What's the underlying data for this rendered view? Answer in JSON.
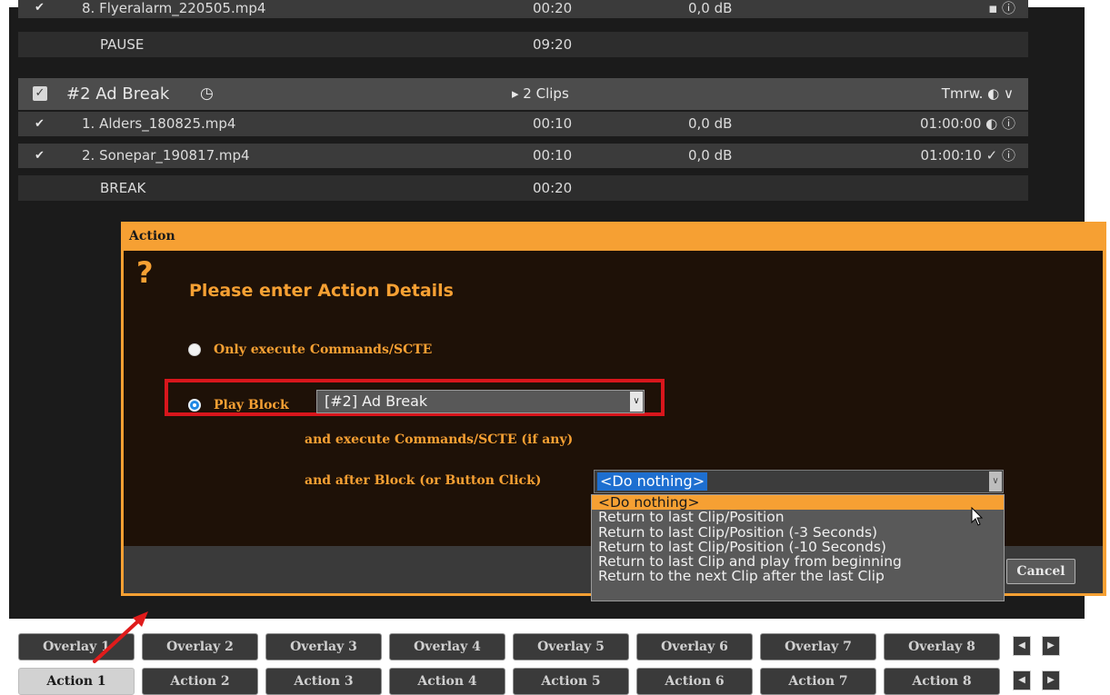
{
  "playlist": {
    "top_clip": {
      "check": "✔",
      "name": "8. Flyeralarm_220505.mp4",
      "duration": "00:20",
      "gain": "0,0 dB",
      "right": "▪ ⓘ"
    },
    "pause_row": {
      "label": "PAUSE",
      "duration": "09:20"
    },
    "block": {
      "check": "✓",
      "title": "#2 Ad Break",
      "clock_icon": "clock-icon",
      "clock_glyph": "◷",
      "clips": "▸ 2 Clips",
      "right": "Tmrw. ◐ ∨"
    },
    "clips": [
      {
        "check": "✔",
        "name": "1. Alders_180825.mp4",
        "duration": "00:10",
        "gain": "0,0 dB",
        "right": "01:00:00 ◐ ⓘ"
      },
      {
        "check": "✔",
        "name": "2. Sonepar_190817.mp4",
        "duration": "00:10",
        "gain": "0,0 dB",
        "right": "01:00:10 ✓ ⓘ"
      }
    ],
    "break_row": {
      "label": "BREAK",
      "duration": "00:20"
    }
  },
  "dialog": {
    "title": "Action",
    "icon": "?",
    "heading": "Please enter Action Details",
    "option_commands": "Only execute Commands/SCTE",
    "option_play_block": "Play Block",
    "block_select_value": "[#2] Ad Break",
    "exec_text": "and execute Commands/SCTE (if any)",
    "after_label": "and after Block (or Button Click)",
    "after_select_value": "<Do nothing>",
    "after_options": [
      "<Do nothing>",
      "Return to last Clip/Position",
      "Return to last Clip/Position (-3 Seconds)",
      "Return to last Clip/Position (-10 Seconds)",
      "Return to last Clip and play from beginning",
      "Return to the next Clip after the last Clip"
    ],
    "selected_option_index": 0,
    "cancel_label": "Cancel"
  },
  "overlay_buttons": [
    "Overlay 1",
    "Overlay 2",
    "Overlay 3",
    "Overlay 4",
    "Overlay 5",
    "Overlay 6",
    "Overlay 7",
    "Overlay 8"
  ],
  "action_buttons": [
    "Action 1",
    "Action 2",
    "Action 3",
    "Action 4",
    "Action 5",
    "Action 6",
    "Action 7",
    "Action 8"
  ],
  "active_action_index": 0,
  "nav": {
    "prev": "◀",
    "next": "▶"
  },
  "colors": {
    "accent": "#f6a033",
    "highlight_box": "#d8161c",
    "selection": "#1e6fd0"
  }
}
